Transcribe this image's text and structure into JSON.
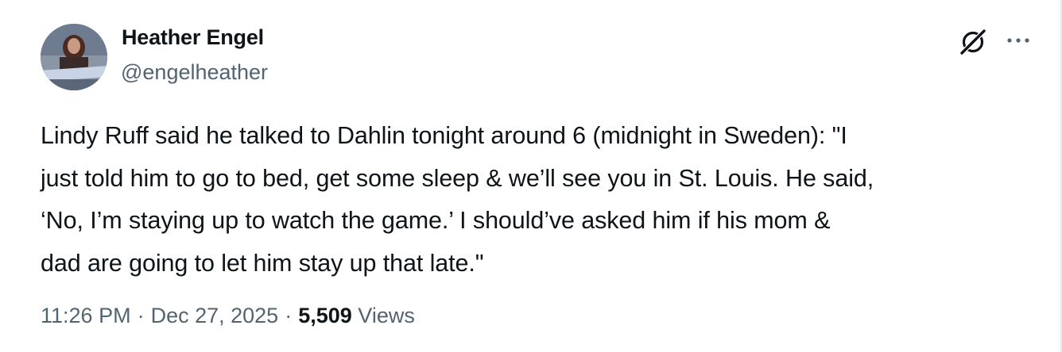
{
  "author": {
    "name": "Heather Engel",
    "handle": "@engelheather"
  },
  "tweet": {
    "text": "Lindy Ruff said he talked to Dahlin tonight around 6 (midnight in Sweden): \"I\njust told him to go to bed, get some sleep & we’ll see you in St. Louis. He said,\n‘No, I’m staying up to watch the game.’ I should’ve asked him if his mom &\ndad are going to let him stay up that late.\""
  },
  "meta": {
    "time": "11:26 PM",
    "separator": "·",
    "date": "Dec 27, 2025",
    "views_count": "5,509",
    "views_label": "Views"
  },
  "icons": {
    "grok": "grok-icon",
    "more": "more-options-icon"
  },
  "colors": {
    "primary_text": "#0f1419",
    "secondary_text": "#536471",
    "background": "#ffffff"
  }
}
